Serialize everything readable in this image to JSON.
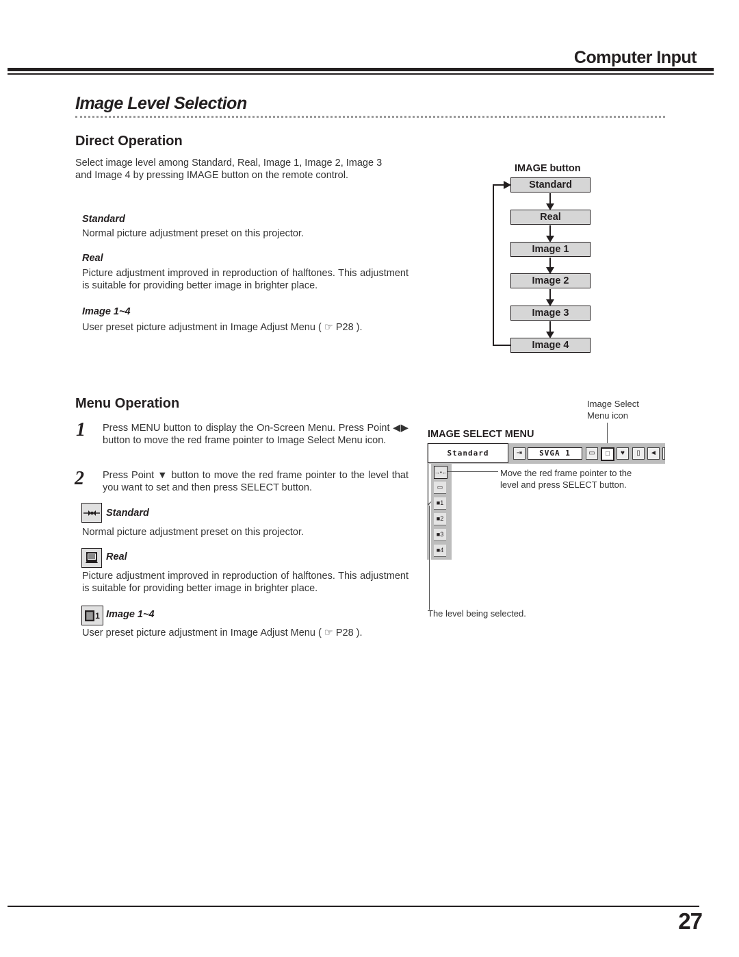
{
  "header": {
    "section": "Computer Input",
    "title": "Image Level Selection"
  },
  "direct_operation": {
    "heading": "Direct Operation",
    "intro_line1": "Select image level among Standard, Real, Image 1, Image 2, Image 3",
    "intro_line2": "and Image 4 by pressing IMAGE button on the remote control.",
    "items": [
      {
        "title": "Standard",
        "desc": "Normal picture adjustment preset on this projector."
      },
      {
        "title": "Real",
        "desc": "Picture adjustment improved in reproduction of halftones.  This adjustment is suitable for providing better image in brighter place."
      },
      {
        "title": "Image 1~4",
        "desc": "User preset picture adjustment in Image Adjust Menu ( ☞ P28 )."
      }
    ],
    "flow": {
      "label": "IMAGE button",
      "steps": [
        "Standard",
        "Real",
        "Image 1",
        "Image 2",
        "Image 3",
        "Image 4"
      ]
    }
  },
  "menu_operation": {
    "heading": "Menu Operation",
    "steps": [
      {
        "num": "1",
        "text": "Press MENU button to display the On-Screen Menu. Press Point ◀▶ button to move the red frame pointer to Image Select Menu icon."
      },
      {
        "num": "2",
        "text": "Press Point ▼ button to move the red frame pointer to the level that you want to set and then press SELECT button."
      }
    ],
    "items": [
      {
        "title": "Standard",
        "icon": "standard-level-icon",
        "desc": "Normal picture adjustment preset on this projector."
      },
      {
        "title": "Real",
        "icon": "real-level-icon",
        "desc": "Picture adjustment improved in reproduction of halftones.  This adjustment is suitable for providing better image in brighter place."
      },
      {
        "title": "Image 1~4",
        "icon": "image-level-icon",
        "icon_label": "1",
        "desc": "User preset picture adjustment in Image Adjust Menu ( ☞ P28 )."
      }
    ],
    "osd": {
      "title": "IMAGE SELECT MENU",
      "current_level": "Standard",
      "source": "SVGA 1",
      "icon_callout_line1": "Image Select",
      "icon_callout_line2": "Menu icon",
      "pointer_callout_line1": "Move the red frame pointer to the",
      "pointer_callout_line2": "level and press SELECT button.",
      "selected_callout": "The level being selected.",
      "levels": [
        "Standard",
        "Real",
        "1",
        "2",
        "3",
        "4"
      ],
      "checked_level": "1",
      "check_mark": "✔"
    }
  },
  "footer": {
    "page_number": "27"
  }
}
